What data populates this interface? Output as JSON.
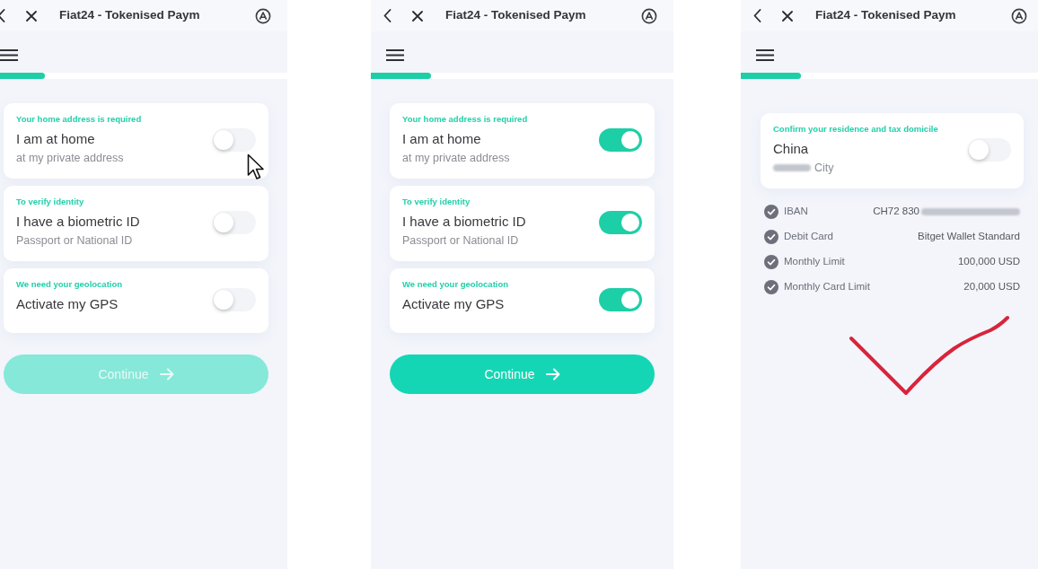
{
  "screens": [
    {
      "header": {
        "title": "Fiat24 - Tokenised Paym"
      },
      "progress": {
        "level": 0.2
      },
      "cards": [
        {
          "label": "Your home address is required",
          "title": "I am at home",
          "subtitle": "at my private address",
          "on": false
        },
        {
          "label": "To verify identity",
          "title": "I have a biometric ID",
          "subtitle": "Passport or National ID",
          "on": false
        },
        {
          "label": "We need your geolocation",
          "title": "Activate my GPS",
          "on": false
        }
      ],
      "continue_button": {
        "label": "Continue",
        "disabled": true
      },
      "cursor": true
    },
    {
      "header": {
        "title": "Fiat24 - Tokenised Paym"
      },
      "progress": {
        "level": 0.2
      },
      "cards": [
        {
          "label": "Your home address is required",
          "title": "I am at home",
          "subtitle": "at my private address",
          "on": true
        },
        {
          "label": "To verify identity",
          "title": "I have a biometric ID",
          "subtitle": "Passport or National ID",
          "on": true
        },
        {
          "label": "We need your geolocation",
          "title": "Activate my GPS",
          "on": true
        }
      ],
      "continue_button": {
        "label": "Continue",
        "disabled": false
      }
    },
    {
      "header": {
        "title": "Fiat24 - Tokenised Paym"
      },
      "progress": {
        "level": 0.2
      },
      "cards": [
        {
          "label": "Confirm your residence and tax domicile",
          "title": "China",
          "subtitle": "City",
          "blur_before": true,
          "on": false
        }
      ],
      "details": [
        {
          "label": "IBAN",
          "value": "CH72 830",
          "blur_after": true
        },
        {
          "label": "Debit Card",
          "value": "Bitget Wallet Standard"
        },
        {
          "label": "Monthly Limit",
          "value": "100,000 USD"
        },
        {
          "label": "Monthly Card Limit",
          "value": "20,000 USD"
        }
      ],
      "annotations": [
        {
          "kind": "check_mark"
        }
      ]
    }
  ]
}
